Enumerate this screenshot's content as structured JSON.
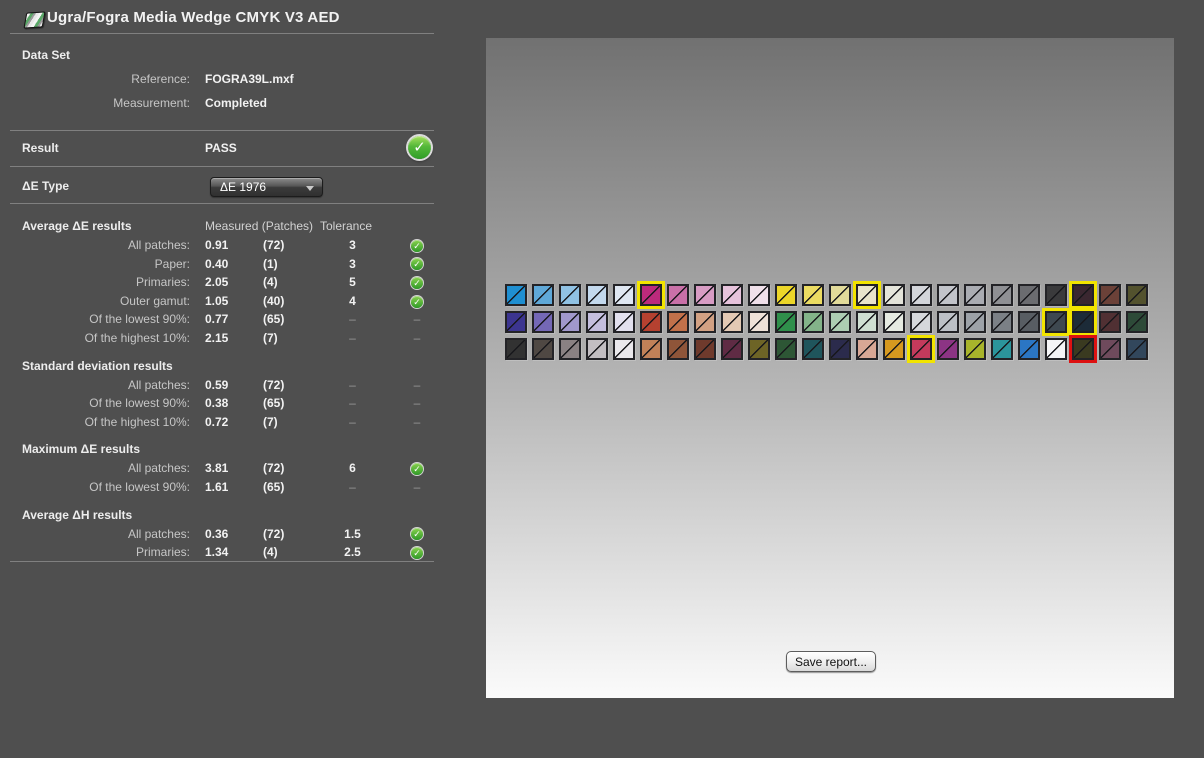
{
  "window": {
    "title": "Ugra/Fogra Media Wedge CMYK V3 AED"
  },
  "data_set": {
    "title": "Data Set",
    "reference_label": "Reference:",
    "reference_value": "FOGRA39L.mxf",
    "measurement_label": "Measurement:",
    "measurement_value": "Completed"
  },
  "result": {
    "label": "Result",
    "value": "PASS",
    "status": "pass"
  },
  "de_type": {
    "label": "ΔE Type",
    "selected": "ΔE 1976"
  },
  "results": {
    "header": {
      "measured": "Measured (Patches)",
      "tolerance": "Tolerance"
    },
    "sections": [
      {
        "title": "Average ΔE results",
        "rows": [
          {
            "label": "All patches:",
            "measured": "0.91",
            "patches": "(72)",
            "tolerance": "3",
            "status": "pass"
          },
          {
            "label": "Paper:",
            "measured": "0.40",
            "patches": "(1)",
            "tolerance": "3",
            "status": "pass"
          },
          {
            "label": "Primaries:",
            "measured": "2.05",
            "patches": "(4)",
            "tolerance": "5",
            "status": "pass"
          },
          {
            "label": "Outer gamut:",
            "measured": "1.05",
            "patches": "(40)",
            "tolerance": "4",
            "status": "pass"
          },
          {
            "label": "Of the lowest 90%:",
            "measured": "0.77",
            "patches": "(65)",
            "tolerance": "–",
            "status": "none"
          },
          {
            "label": "Of the highest 10%:",
            "measured": "2.15",
            "patches": "(7)",
            "tolerance": "–",
            "status": "none"
          }
        ]
      },
      {
        "title": "Standard deviation results",
        "rows": [
          {
            "label": "All patches:",
            "measured": "0.59",
            "patches": "(72)",
            "tolerance": "–",
            "status": "none"
          },
          {
            "label": "Of the lowest 90%:",
            "measured": "0.38",
            "patches": "(65)",
            "tolerance": "–",
            "status": "none"
          },
          {
            "label": "Of the highest 10%:",
            "measured": "0.72",
            "patches": "(7)",
            "tolerance": "–",
            "status": "none"
          }
        ]
      },
      {
        "title": "Maximum ΔE results",
        "rows": [
          {
            "label": "All patches:",
            "measured": "3.81",
            "patches": "(72)",
            "tolerance": "6",
            "status": "pass"
          },
          {
            "label": "Of the lowest 90%:",
            "measured": "1.61",
            "patches": "(65)",
            "tolerance": "–",
            "status": "none"
          }
        ]
      },
      {
        "title": "Average ΔH results",
        "rows": [
          {
            "label": "All patches:",
            "measured": "0.36",
            "patches": "(72)",
            "tolerance": "1.5",
            "status": "pass"
          },
          {
            "label": "Primaries:",
            "measured": "1.34",
            "patches": "(4)",
            "tolerance": "2.5",
            "status": "pass"
          }
        ]
      }
    ]
  },
  "preview": {
    "save_button_label": "Save report...",
    "patch_rows": [
      [
        {
          "c": "#1f8fd1"
        },
        {
          "c": "#5fa8d8"
        },
        {
          "c": "#90c2e4"
        },
        {
          "c": "#c3d9ee"
        },
        {
          "c": "#dfe7f2"
        },
        {
          "c": "#bc2a7c",
          "hl": "yellow"
        },
        {
          "c": "#c970a8"
        },
        {
          "c": "#d89cc4"
        },
        {
          "c": "#e7c3dc"
        },
        {
          "c": "#f0e0ea"
        },
        {
          "c": "#ecd629"
        },
        {
          "c": "#ecdc62"
        },
        {
          "c": "#e2db9a"
        },
        {
          "c": "#e9e4cb",
          "hl": "yellow"
        },
        {
          "c": "#e4e4da"
        },
        {
          "c": "#d3d5da"
        },
        {
          "c": "#c2c4ca"
        },
        {
          "c": "#aaacb2"
        },
        {
          "c": "#8f9094"
        },
        {
          "c": "#6b6c70"
        },
        {
          "c": "#3a3a3c"
        },
        {
          "c": "#3a2730",
          "hl": "yellow"
        },
        {
          "c": "#6b4138"
        },
        {
          "c": "#53522e"
        }
      ],
      [
        {
          "c": "#3c3590"
        },
        {
          "c": "#7468b6"
        },
        {
          "c": "#a198cc"
        },
        {
          "c": "#c4bede"
        },
        {
          "c": "#e2e0ee"
        },
        {
          "c": "#b54130"
        },
        {
          "c": "#c2714a"
        },
        {
          "c": "#d2a183"
        },
        {
          "c": "#e3c9b4"
        },
        {
          "c": "#eee1d8"
        },
        {
          "c": "#2f8f4b"
        },
        {
          "c": "#83b389"
        },
        {
          "c": "#adcdb2"
        },
        {
          "c": "#cfdfd2"
        },
        {
          "c": "#e6ebe2"
        },
        {
          "c": "#d5d7db"
        },
        {
          "c": "#bcc0c6"
        },
        {
          "c": "#9da2a8"
        },
        {
          "c": "#7b8086"
        },
        {
          "c": "#585d63"
        },
        {
          "c": "#3e4850",
          "hl": "yellow"
        },
        {
          "c": "#1c2b38",
          "hl": "yellow"
        },
        {
          "c": "#503033"
        },
        {
          "c": "#2d4a38"
        }
      ],
      [
        {
          "c": "#323232"
        },
        {
          "c": "#4f4843"
        },
        {
          "c": "#8a8183"
        },
        {
          "c": "#c2bec2"
        },
        {
          "c": "#eae8ec"
        },
        {
          "c": "#c28158"
        },
        {
          "c": "#8f5539"
        },
        {
          "c": "#6f3a2c"
        },
        {
          "c": "#5f2b44"
        },
        {
          "c": "#6d6426"
        },
        {
          "c": "#2d5635"
        },
        {
          "c": "#1f555c"
        },
        {
          "c": "#2b2b4c"
        },
        {
          "c": "#d8a795"
        },
        {
          "c": "#d6991f"
        },
        {
          "c": "#c43a5c",
          "hl": "yellow"
        },
        {
          "c": "#8c3484"
        },
        {
          "c": "#a8b42b"
        },
        {
          "c": "#2b959c"
        },
        {
          "c": "#2b76c4"
        },
        {
          "c": "#f5f5f7"
        },
        {
          "c": "#3a3a20",
          "hl": "red"
        },
        {
          "c": "#6f4a5c"
        },
        {
          "c": "#32475c"
        }
      ]
    ]
  },
  "colors": {
    "pass_green": "#2f9e27",
    "warning_yellow": "#f2e400",
    "fail_red": "#dd1111",
    "panel_background": "#4f4f4f"
  },
  "icons": {
    "title": "media-wedge-icon",
    "result": "pass-check-icon",
    "dropdown": "chevron-down-icon"
  }
}
